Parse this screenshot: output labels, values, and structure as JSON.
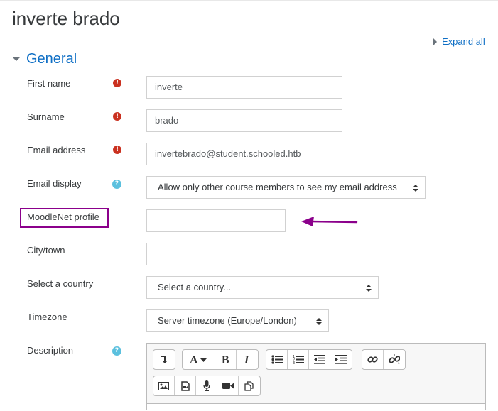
{
  "page": {
    "title": "inverte brado"
  },
  "expand_all": {
    "label": "Expand all"
  },
  "section": {
    "label": "General"
  },
  "fields": {
    "first_name": {
      "label": "First name",
      "value": "inverte"
    },
    "surname": {
      "label": "Surname",
      "value": "brado"
    },
    "email": {
      "label": "Email address",
      "value": "invertebrado@student.schooled.htb"
    },
    "email_display": {
      "label": "Email display",
      "value": "Allow only other course members to see my email address"
    },
    "moodlenet": {
      "label": "MoodleNet profile",
      "value": ""
    },
    "city": {
      "label": "City/town",
      "value": ""
    },
    "country": {
      "label": "Select a country",
      "value": "Select a country..."
    },
    "timezone": {
      "label": "Timezone",
      "value": "Server timezone (Europe/London)"
    },
    "description": {
      "label": "Description"
    }
  },
  "icons": {
    "required": "exclamation-icon",
    "help": "question-icon"
  },
  "annotation": {
    "color": "#8b008b"
  },
  "colors": {
    "link": "#0f6fc5",
    "required": "#ca3120",
    "help": "#5bc0de"
  }
}
